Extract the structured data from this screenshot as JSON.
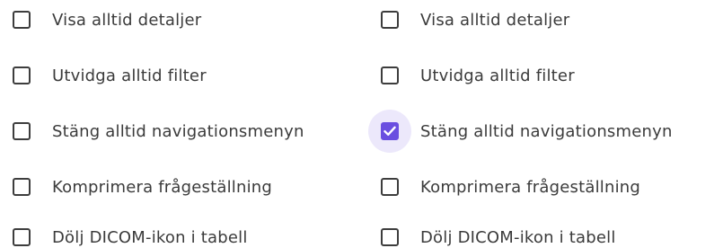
{
  "left_column": {
    "items": [
      {
        "label": "Visa alltid detaljer",
        "checked": false
      },
      {
        "label": "Utvidga alltid filter",
        "checked": false
      },
      {
        "label": "Stäng alltid navigationsmenyn",
        "checked": false
      },
      {
        "label": "Komprimera frågeställning",
        "checked": false
      },
      {
        "label": "Dölj DICOM-ikon i tabell",
        "checked": false
      }
    ]
  },
  "right_column": {
    "items": [
      {
        "label": "Visa alltid detaljer",
        "checked": false
      },
      {
        "label": "Utvidga alltid filter",
        "checked": false
      },
      {
        "label": "Stäng alltid navigationsmenyn",
        "checked": true
      },
      {
        "label": "Komprimera frågeställning",
        "checked": false
      },
      {
        "label": "Dölj DICOM-ikon i tabell",
        "checked": false
      }
    ]
  },
  "colors": {
    "accent": "#6a4fe0",
    "focus_halo": "#ece8fb",
    "text": "#3b3b3b",
    "checkbox_border": "#3d3d3d"
  },
  "icons": {
    "checkmark": "checkmark-icon"
  }
}
